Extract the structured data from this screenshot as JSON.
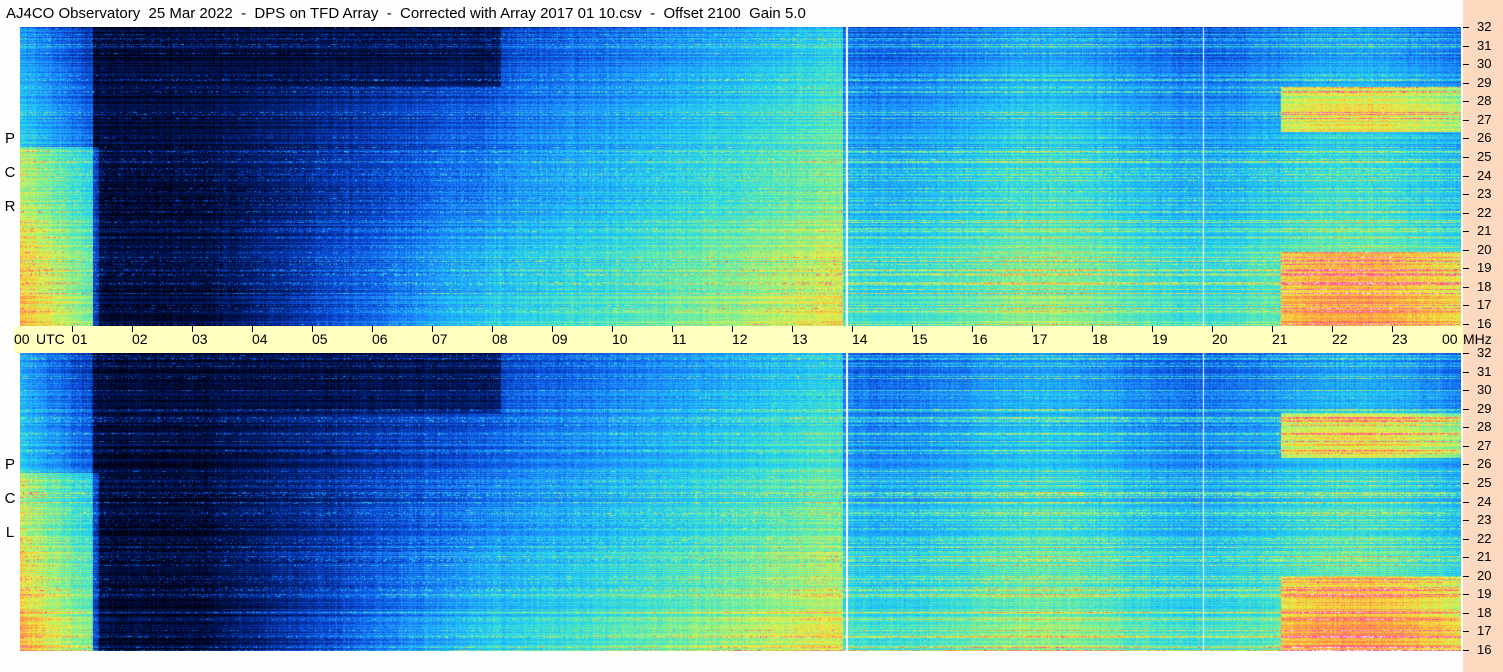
{
  "title": "AJ4CO Observatory  25 Mar 2022  -  DPS on TFD Array  -  Corrected with Array 2017 01 10.csv  -  Offset 2100  Gain 5.0",
  "panels": {
    "top": {
      "letters": [
        "R",
        "C",
        "P"
      ]
    },
    "bottom": {
      "letters": [
        "L",
        "C",
        "P"
      ]
    }
  },
  "time_axis": {
    "start_label": "00",
    "unit_label": "UTC",
    "hour_labels": [
      "01",
      "02",
      "03",
      "04",
      "05",
      "06",
      "07",
      "08",
      "09",
      "10",
      "11",
      "12",
      "13",
      "14",
      "15",
      "16",
      "17",
      "18",
      "19",
      "20",
      "21",
      "22",
      "23"
    ],
    "end_label": "00",
    "freq_unit_label": "MHz"
  },
  "freq_axis": {
    "labels": [
      "32",
      "31",
      "30",
      "29",
      "28",
      "27",
      "26",
      "25",
      "24",
      "23",
      "22",
      "21",
      "20",
      "19",
      "18",
      "17",
      "16"
    ]
  },
  "colors": {
    "background": "#fefefe",
    "timebar": "#ffffc0",
    "freq_strip": "#fcd9bf",
    "colormap": [
      "#000010",
      "#001a66",
      "#0a48d8",
      "#1e90ff",
      "#22d3f0",
      "#6ef0a0",
      "#f0f040",
      "#ff9040",
      "#ff30c0",
      "#ffffff"
    ]
  },
  "chart_data": {
    "type": "heatmap",
    "title": "AJ4CO Observatory  25 Mar 2022  -  DPS on TFD Array  -  Corrected with Array 2017 01 10.csv  -  Offset 2100  Gain 5.0",
    "xlabel": "UTC",
    "ylabel": "MHz",
    "xlim": [
      0,
      24
    ],
    "ylim": [
      16,
      32
    ],
    "panels": [
      "RCP",
      "LCP"
    ],
    "vertical_markers_utc": [
      13.75,
      19.7
    ]
  }
}
